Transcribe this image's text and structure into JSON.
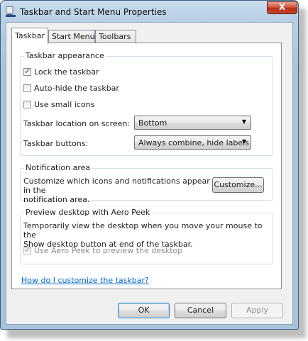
{
  "window": {
    "title": "Taskbar and Start Menu Properties",
    "close_glyph": "X"
  },
  "tabs": [
    {
      "label": "Taskbar",
      "active": true
    },
    {
      "label": "Start Menu",
      "active": false
    },
    {
      "label": "Toolbars",
      "active": false
    }
  ],
  "appearance": {
    "title": "Taskbar appearance",
    "lock": {
      "label": "Lock the taskbar",
      "checked": true
    },
    "autohide": {
      "label": "Auto-hide the taskbar",
      "checked": false
    },
    "small_icons": {
      "label": "Use small icons",
      "checked": false
    },
    "location_label": "Taskbar location on screen:",
    "location_value": "Bottom",
    "buttons_label": "Taskbar buttons:",
    "buttons_value": "Always combine, hide labels"
  },
  "notification": {
    "title": "Notification area",
    "text_line1": "Customize which icons and notifications appear in the",
    "text_line2": "notification area.",
    "customize_label": "Customize..."
  },
  "aero_peek": {
    "title": "Preview desktop with Aero Peek",
    "text_line1": "Temporarily view the desktop when you move your mouse to the",
    "text_line2": "Show desktop button at end of the taskbar.",
    "checkbox_label": "Use Aero Peek to preview the desktop",
    "checked": true,
    "enabled": false
  },
  "help_link": "How do I customize the taskbar?",
  "footer": {
    "ok_label": "OK",
    "cancel_label": "Cancel",
    "apply_label": "Apply"
  },
  "colors": {
    "accent_link": "#0066cc",
    "close_button": "#c7462c",
    "frame": "#b8cfe4"
  }
}
